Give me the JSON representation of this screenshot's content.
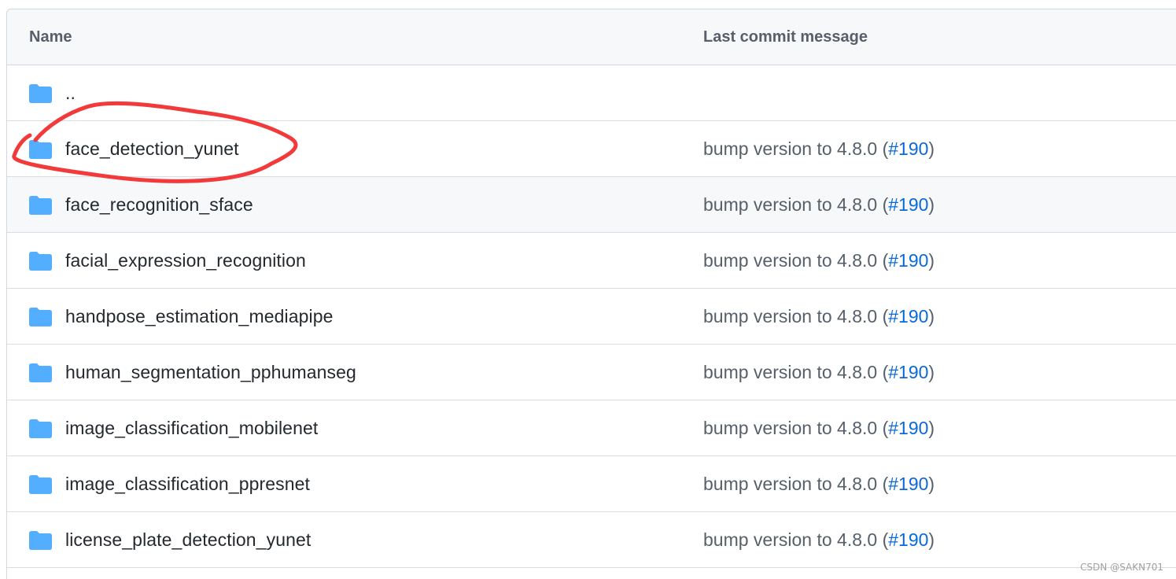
{
  "table": {
    "header": {
      "name": "Name",
      "message": "Last commit message"
    },
    "rows": [
      {
        "name": "..",
        "message": "",
        "pr": ""
      },
      {
        "name": "face_detection_yunet",
        "message": "bump version to 4.8.0 (",
        "pr": "#190",
        "close": ")"
      },
      {
        "name": "face_recognition_sface",
        "message": "bump version to 4.8.0 (",
        "pr": "#190",
        "close": ")"
      },
      {
        "name": "facial_expression_recognition",
        "message": "bump version to 4.8.0 (",
        "pr": "#190",
        "close": ")"
      },
      {
        "name": "handpose_estimation_mediapipe",
        "message": "bump version to 4.8.0 (",
        "pr": "#190",
        "close": ")"
      },
      {
        "name": "human_segmentation_pphumanseg",
        "message": "bump version to 4.8.0 (",
        "pr": "#190",
        "close": ")"
      },
      {
        "name": "image_classification_mobilenet",
        "message": "bump version to 4.8.0 (",
        "pr": "#190",
        "close": ")"
      },
      {
        "name": "image_classification_ppresnet",
        "message": "bump version to 4.8.0 (",
        "pr": "#190",
        "close": ")"
      },
      {
        "name": "license_plate_detection_yunet",
        "message": "bump version to 4.8.0 (",
        "pr": "#190",
        "close": ")"
      }
    ]
  },
  "icons": {
    "folder": "folder-icon"
  },
  "colors": {
    "folder": "#54aeff",
    "link": "#0969da",
    "annotation": "#f23a3a"
  },
  "watermark": "CSDN @SAKN701"
}
